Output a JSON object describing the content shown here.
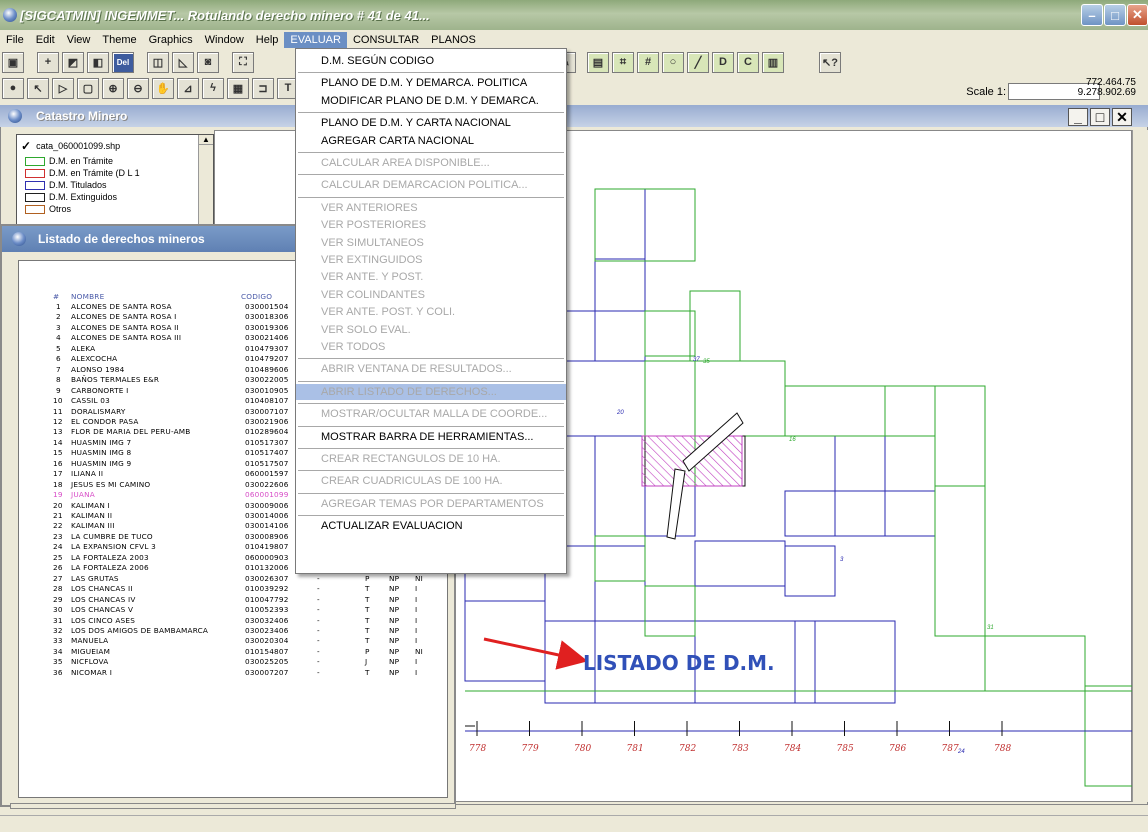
{
  "window": {
    "title": "[SIGCATMIN] INGEMMET... Rotulando derecho minero # 41 de 41..."
  },
  "menubar": [
    "File",
    "Edit",
    "View",
    "Theme",
    "Graphics",
    "Window",
    "Help",
    "EVALUAR",
    "CONSULTAR",
    "PLANOS"
  ],
  "scale_label": "Scale 1:",
  "coords": {
    "x": "772.464.75",
    "y": "9.278.902.69"
  },
  "map_window": {
    "title": "Catastro Minero"
  },
  "toc": {
    "layer": "cata_060001099.shp",
    "legend": [
      {
        "label": "D.M. en Trámite",
        "color": "#2ea82e"
      },
      {
        "label": "D.M. en Trámite (D L 1",
        "color": "#d03030"
      },
      {
        "label": "D.M. Titulados",
        "color": "#3030b0"
      },
      {
        "label": "D.M. Extinguidos",
        "color": "#202020"
      },
      {
        "label": "Otros",
        "color": "#b06020"
      }
    ]
  },
  "list_window": {
    "title": "Listado de derechos mineros",
    "headers": {
      "num": "#",
      "nombre": "NOMBRE",
      "codigo": "CODIGO"
    },
    "rows": [
      [
        "1",
        "ALCONES DE SANTA ROSA",
        "030001504",
        "",
        "",
        "",
        ""
      ],
      [
        "2",
        "ALCONES DE SANTA ROSA I",
        "030018306",
        "",
        "",
        "",
        ""
      ],
      [
        "3",
        "ALCONES DE SANTA ROSA II",
        "030019306",
        "",
        "",
        "",
        ""
      ],
      [
        "4",
        "ALCONES DE SANTA ROSA III",
        "030021406",
        "",
        "",
        "",
        ""
      ],
      [
        "5",
        "ALEKA",
        "010479307",
        "",
        "",
        "",
        ""
      ],
      [
        "6",
        "ALEXCOCHA",
        "010479207",
        "",
        "",
        "",
        ""
      ],
      [
        "7",
        "ALONSO 1984",
        "010489606",
        "",
        "",
        "",
        ""
      ],
      [
        "8",
        "BAÑOS TERMALES E&R",
        "030022005",
        "",
        "",
        "",
        ""
      ],
      [
        "9",
        "CARBONORTE I",
        "030010905",
        "",
        "",
        "",
        ""
      ],
      [
        "10",
        "CASSIL 03",
        "010408107",
        "",
        "",
        "",
        ""
      ],
      [
        "11",
        "DORALISMARY",
        "030007107",
        "",
        "",
        "",
        ""
      ],
      [
        "12",
        "EL CONDOR PASA",
        "030021906",
        "",
        "",
        "",
        ""
      ],
      [
        "13",
        "FLOR DE MARIA DEL PERU-AMB",
        "010289604",
        "",
        "",
        "",
        ""
      ],
      [
        "14",
        "HUASMIN IMG 7",
        "010517307",
        "",
        "",
        "",
        ""
      ],
      [
        "15",
        "HUASMIN IMG 8",
        "010517407",
        "",
        "",
        "",
        ""
      ],
      [
        "16",
        "HUASMIN IMG 9",
        "010517507",
        "",
        "",
        "",
        ""
      ],
      [
        "17",
        "ILIANA II",
        "060001597",
        "",
        "",
        "",
        ""
      ],
      [
        "18",
        "JESUS ES MI CAMINO",
        "030022606",
        "",
        "",
        "",
        ""
      ],
      [
        "19",
        "JUANA",
        "060001099",
        "",
        "",
        "",
        ""
      ],
      [
        "20",
        "KALIMAN I",
        "030009006",
        "",
        "",
        "",
        ""
      ],
      [
        "21",
        "KALIMAN II",
        "030014006",
        "",
        "",
        "",
        ""
      ],
      [
        "22",
        "KALIMAN III",
        "030014106",
        "",
        "T",
        "NP",
        "I"
      ],
      [
        "23",
        "LA CUMBRE DE TUCO",
        "030008906",
        "-",
        "T",
        "NP",
        "I"
      ],
      [
        "24",
        "LA EXPANSION CFVL 3",
        "010419807",
        "-",
        "P",
        "NP",
        "NI"
      ],
      [
        "25",
        "LA FORTALEZA 2003",
        "060000903",
        "-",
        "T",
        "NP",
        "I"
      ],
      [
        "26",
        "LA FORTALEZA 2006",
        "010132006",
        "-",
        "T",
        "NP",
        "I"
      ],
      [
        "27",
        "LAS GRUTAS",
        "030026307",
        "-",
        "P",
        "NP",
        "NI"
      ],
      [
        "28",
        "LOS CHANCAS II",
        "010039292",
        "-",
        "T",
        "NP",
        "I"
      ],
      [
        "29",
        "LOS CHANCAS IV",
        "010047792",
        "-",
        "T",
        "NP",
        "I"
      ],
      [
        "30",
        "LOS CHANCAS V",
        "010052393",
        "-",
        "T",
        "NP",
        "I"
      ],
      [
        "31",
        "LOS CINCO ASES",
        "030032406",
        "-",
        "T",
        "NP",
        "I"
      ],
      [
        "32",
        "LOS DOS AMIGOS DE BAMBAMARCA",
        "030023406",
        "-",
        "T",
        "NP",
        "I"
      ],
      [
        "33",
        "MANUELA",
        "030020304",
        "-",
        "T",
        "NP",
        "I"
      ],
      [
        "34",
        "MIGUEIAM",
        "010154807",
        "-",
        "P",
        "NP",
        "NI"
      ],
      [
        "35",
        "NICFLOVA",
        "030025205",
        "-",
        "J",
        "NP",
        "I"
      ],
      [
        "36",
        "NICOMAR I",
        "030007207",
        "-",
        "T",
        "NP",
        "I"
      ]
    ],
    "selected_index": 18
  },
  "menu": {
    "items": [
      {
        "label": "D.M. SEGÚN CODIGO",
        "enabled": true
      },
      {
        "sep": true
      },
      {
        "label": "PLANO DE D.M. Y DEMARCA. POLITICA",
        "enabled": true
      },
      {
        "label": "MODIFICAR PLANO DE D.M. Y DEMARCA.",
        "enabled": true
      },
      {
        "sep": true
      },
      {
        "label": "PLANO DE D.M. Y CARTA NACIONAL",
        "enabled": true
      },
      {
        "label": "AGREGAR CARTA NACIONAL",
        "enabled": true
      },
      {
        "sep": true
      },
      {
        "label": "CALCULAR AREA DISPONIBLE...",
        "enabled": false
      },
      {
        "sep": true
      },
      {
        "label": "CALCULAR DEMARCACION POLITICA...",
        "enabled": false
      },
      {
        "sep": true
      },
      {
        "label": "VER ANTERIORES",
        "enabled": false
      },
      {
        "label": "VER POSTERIORES",
        "enabled": false
      },
      {
        "label": "VER SIMULTANEOS",
        "enabled": false
      },
      {
        "label": "VER EXTINGUIDOS",
        "enabled": false
      },
      {
        "label": "VER ANTE. Y POST.",
        "enabled": false
      },
      {
        "label": "VER COLINDANTES",
        "enabled": false
      },
      {
        "label": "VER ANTE. POST. Y COLI.",
        "enabled": false
      },
      {
        "label": "VER SOLO EVAL.",
        "enabled": false
      },
      {
        "label": "VER TODOS",
        "enabled": false
      },
      {
        "sep": true
      },
      {
        "label": "ABRIR VENTANA DE RESULTADOS...",
        "enabled": false
      },
      {
        "sep": true
      },
      {
        "label": "ABRIR LISTADO DE DERECHOS...",
        "enabled": false,
        "highlight": true
      },
      {
        "sep": true
      },
      {
        "label": "MOSTRAR/OCULTAR MALLA DE COORDE...",
        "enabled": false
      },
      {
        "sep": true
      },
      {
        "label": "MOSTRAR BARRA DE HERRAMIENTAS...",
        "enabled": true
      },
      {
        "sep": true
      },
      {
        "label": "CREAR RECTANGULOS DE 10 HA.",
        "enabled": false
      },
      {
        "sep": true
      },
      {
        "label": "CREAR CUADRICULAS DE 100 HA.",
        "enabled": false
      },
      {
        "sep": true
      },
      {
        "label": "AGREGAR TEMAS POR DEPARTAMENTOS",
        "enabled": false
      },
      {
        "sep": true
      },
      {
        "label": "ACTUALIZAR EVALUACION",
        "enabled": true
      }
    ]
  },
  "map": {
    "axis_labels": [
      "778",
      "779",
      "780",
      "781",
      "782",
      "783",
      "784",
      "785",
      "786",
      "787",
      "788"
    ],
    "grid_labels": [
      "20",
      "35",
      "3",
      "31",
      "37",
      "16",
      "24"
    ]
  },
  "annotation": "LISTADO DE D.M.",
  "colors": {
    "green": "#2ea82e",
    "blue": "#2a2ab0",
    "black": "#101010",
    "pink": "#c040c0",
    "annot": "#3050b8",
    "arrow": "#e02020"
  }
}
